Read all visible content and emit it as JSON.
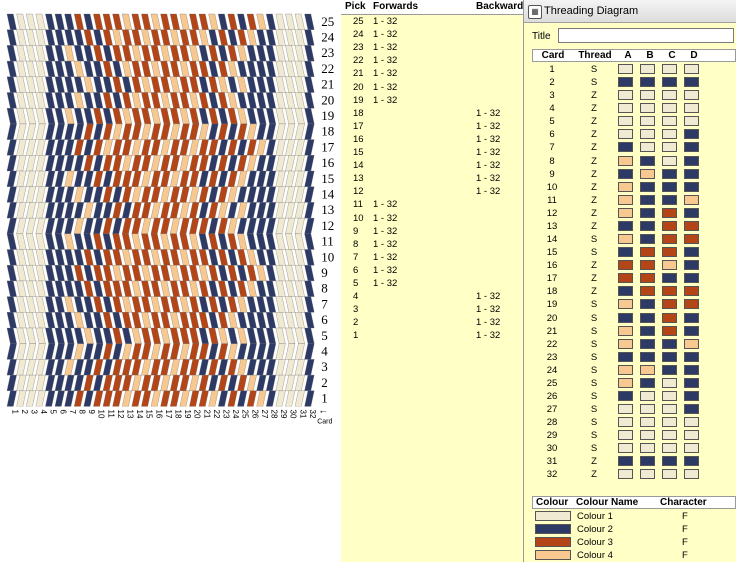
{
  "picks_pane": {
    "header": {
      "pick": "Pick",
      "forwards": "Forwards",
      "backwards": "Backward"
    },
    "rows": [
      {
        "pick": "25",
        "fwd": "1 - 32",
        "bwd": ""
      },
      {
        "pick": "24",
        "fwd": "1 - 32",
        "bwd": ""
      },
      {
        "pick": "23",
        "fwd": "1 - 32",
        "bwd": ""
      },
      {
        "pick": "22",
        "fwd": "1 - 32",
        "bwd": ""
      },
      {
        "pick": "21",
        "fwd": "1 - 32",
        "bwd": ""
      },
      {
        "pick": "20",
        "fwd": "1 - 32",
        "bwd": ""
      },
      {
        "pick": "19",
        "fwd": "1 - 32",
        "bwd": ""
      },
      {
        "pick": "18",
        "fwd": "",
        "bwd": "1 - 32"
      },
      {
        "pick": "17",
        "fwd": "",
        "bwd": "1 - 32"
      },
      {
        "pick": "16",
        "fwd": "",
        "bwd": "1 - 32"
      },
      {
        "pick": "15",
        "fwd": "",
        "bwd": "1 - 32"
      },
      {
        "pick": "14",
        "fwd": "",
        "bwd": "1 - 32"
      },
      {
        "pick": "13",
        "fwd": "",
        "bwd": "1 - 32"
      },
      {
        "pick": "12",
        "fwd": "",
        "bwd": "1 - 32"
      },
      {
        "pick": "11",
        "fwd": "1 - 32",
        "bwd": ""
      },
      {
        "pick": "10",
        "fwd": "1 - 32",
        "bwd": ""
      },
      {
        "pick": "9",
        "fwd": "1 - 32",
        "bwd": ""
      },
      {
        "pick": "8",
        "fwd": "1 - 32",
        "bwd": ""
      },
      {
        "pick": "7",
        "fwd": "1 - 32",
        "bwd": ""
      },
      {
        "pick": "6",
        "fwd": "1 - 32",
        "bwd": ""
      },
      {
        "pick": "5",
        "fwd": "1 - 32",
        "bwd": ""
      },
      {
        "pick": "4",
        "fwd": "",
        "bwd": "1 - 32"
      },
      {
        "pick": "3",
        "fwd": "",
        "bwd": "1 - 32"
      },
      {
        "pick": "2",
        "fwd": "",
        "bwd": "1 - 32"
      },
      {
        "pick": "1",
        "fwd": "",
        "bwd": "1 - 32"
      }
    ]
  },
  "pattern": {
    "pick_labels": [
      "25",
      "24",
      "23",
      "22",
      "21",
      "20",
      "19",
      "18",
      "17",
      "16",
      "15",
      "14",
      "13",
      "12",
      "11",
      "10",
      "9",
      "8",
      "7",
      "6",
      "5",
      "4",
      "3",
      "2",
      "1"
    ],
    "card_axis_label": "Card",
    "cards": 32
  },
  "threading": {
    "window_title": "Threading Diagram",
    "title_label": "Title",
    "title_value": "",
    "columns": {
      "card": "Card",
      "thread": "Thread",
      "a": "A",
      "b": "B",
      "c": "C",
      "d": "D"
    },
    "rows": [
      {
        "card": "1",
        "thread": "S",
        "holes": [
          1,
          1,
          1,
          1
        ]
      },
      {
        "card": "2",
        "thread": "S",
        "holes": [
          2,
          2,
          2,
          2
        ]
      },
      {
        "card": "3",
        "thread": "Z",
        "holes": [
          1,
          1,
          1,
          1
        ]
      },
      {
        "card": "4",
        "thread": "Z",
        "holes": [
          1,
          1,
          1,
          1
        ]
      },
      {
        "card": "5",
        "thread": "Z",
        "holes": [
          1,
          1,
          1,
          1
        ]
      },
      {
        "card": "6",
        "thread": "Z",
        "holes": [
          1,
          1,
          1,
          2
        ]
      },
      {
        "card": "7",
        "thread": "Z",
        "holes": [
          2,
          1,
          1,
          2
        ]
      },
      {
        "card": "8",
        "thread": "Z",
        "holes": [
          4,
          2,
          1,
          2
        ]
      },
      {
        "card": "9",
        "thread": "Z",
        "holes": [
          2,
          4,
          2,
          2
        ]
      },
      {
        "card": "10",
        "thread": "Z",
        "holes": [
          4,
          2,
          2,
          2
        ]
      },
      {
        "card": "11",
        "thread": "Z",
        "holes": [
          4,
          2,
          2,
          4
        ]
      },
      {
        "card": "12",
        "thread": "Z",
        "holes": [
          4,
          2,
          3,
          2
        ]
      },
      {
        "card": "13",
        "thread": "Z",
        "holes": [
          2,
          2,
          3,
          3
        ]
      },
      {
        "card": "14",
        "thread": "S",
        "holes": [
          4,
          2,
          3,
          3
        ]
      },
      {
        "card": "15",
        "thread": "S",
        "holes": [
          2,
          3,
          3,
          2
        ]
      },
      {
        "card": "16",
        "thread": "Z",
        "holes": [
          3,
          3,
          4,
          2
        ]
      },
      {
        "card": "17",
        "thread": "Z",
        "holes": [
          3,
          3,
          2,
          2
        ]
      },
      {
        "card": "18",
        "thread": "Z",
        "holes": [
          2,
          3,
          3,
          3
        ]
      },
      {
        "card": "19",
        "thread": "S",
        "holes": [
          4,
          2,
          3,
          3
        ]
      },
      {
        "card": "20",
        "thread": "S",
        "holes": [
          2,
          2,
          3,
          2
        ]
      },
      {
        "card": "21",
        "thread": "S",
        "holes": [
          4,
          2,
          3,
          2
        ]
      },
      {
        "card": "22",
        "thread": "S",
        "holes": [
          4,
          2,
          2,
          4
        ]
      },
      {
        "card": "23",
        "thread": "S",
        "holes": [
          2,
          2,
          2,
          2
        ]
      },
      {
        "card": "24",
        "thread": "S",
        "holes": [
          4,
          4,
          2,
          2
        ]
      },
      {
        "card": "25",
        "thread": "S",
        "holes": [
          4,
          2,
          1,
          2
        ]
      },
      {
        "card": "26",
        "thread": "S",
        "holes": [
          2,
          1,
          1,
          2
        ]
      },
      {
        "card": "27",
        "thread": "S",
        "holes": [
          1,
          1,
          1,
          2
        ]
      },
      {
        "card": "28",
        "thread": "S",
        "holes": [
          1,
          1,
          1,
          1
        ]
      },
      {
        "card": "29",
        "thread": "S",
        "holes": [
          1,
          1,
          1,
          1
        ]
      },
      {
        "card": "30",
        "thread": "S",
        "holes": [
          1,
          1,
          1,
          1
        ]
      },
      {
        "card": "31",
        "thread": "Z",
        "holes": [
          2,
          2,
          2,
          2
        ]
      },
      {
        "card": "32",
        "thread": "Z",
        "holes": [
          1,
          1,
          1,
          1
        ]
      }
    ]
  },
  "colours": {
    "header": {
      "colour": "Colour",
      "name": "Colour Name",
      "character": "Character"
    },
    "items": [
      {
        "hex": "#f1ead2",
        "name": "Colour 1",
        "character": "F"
      },
      {
        "hex": "#2e3a66",
        "name": "Colour 2",
        "character": "F"
      },
      {
        "hex": "#b34516",
        "name": "Colour 3",
        "character": "F"
      },
      {
        "hex": "#f7c88f",
        "name": "Colour 4",
        "character": "F"
      }
    ]
  }
}
